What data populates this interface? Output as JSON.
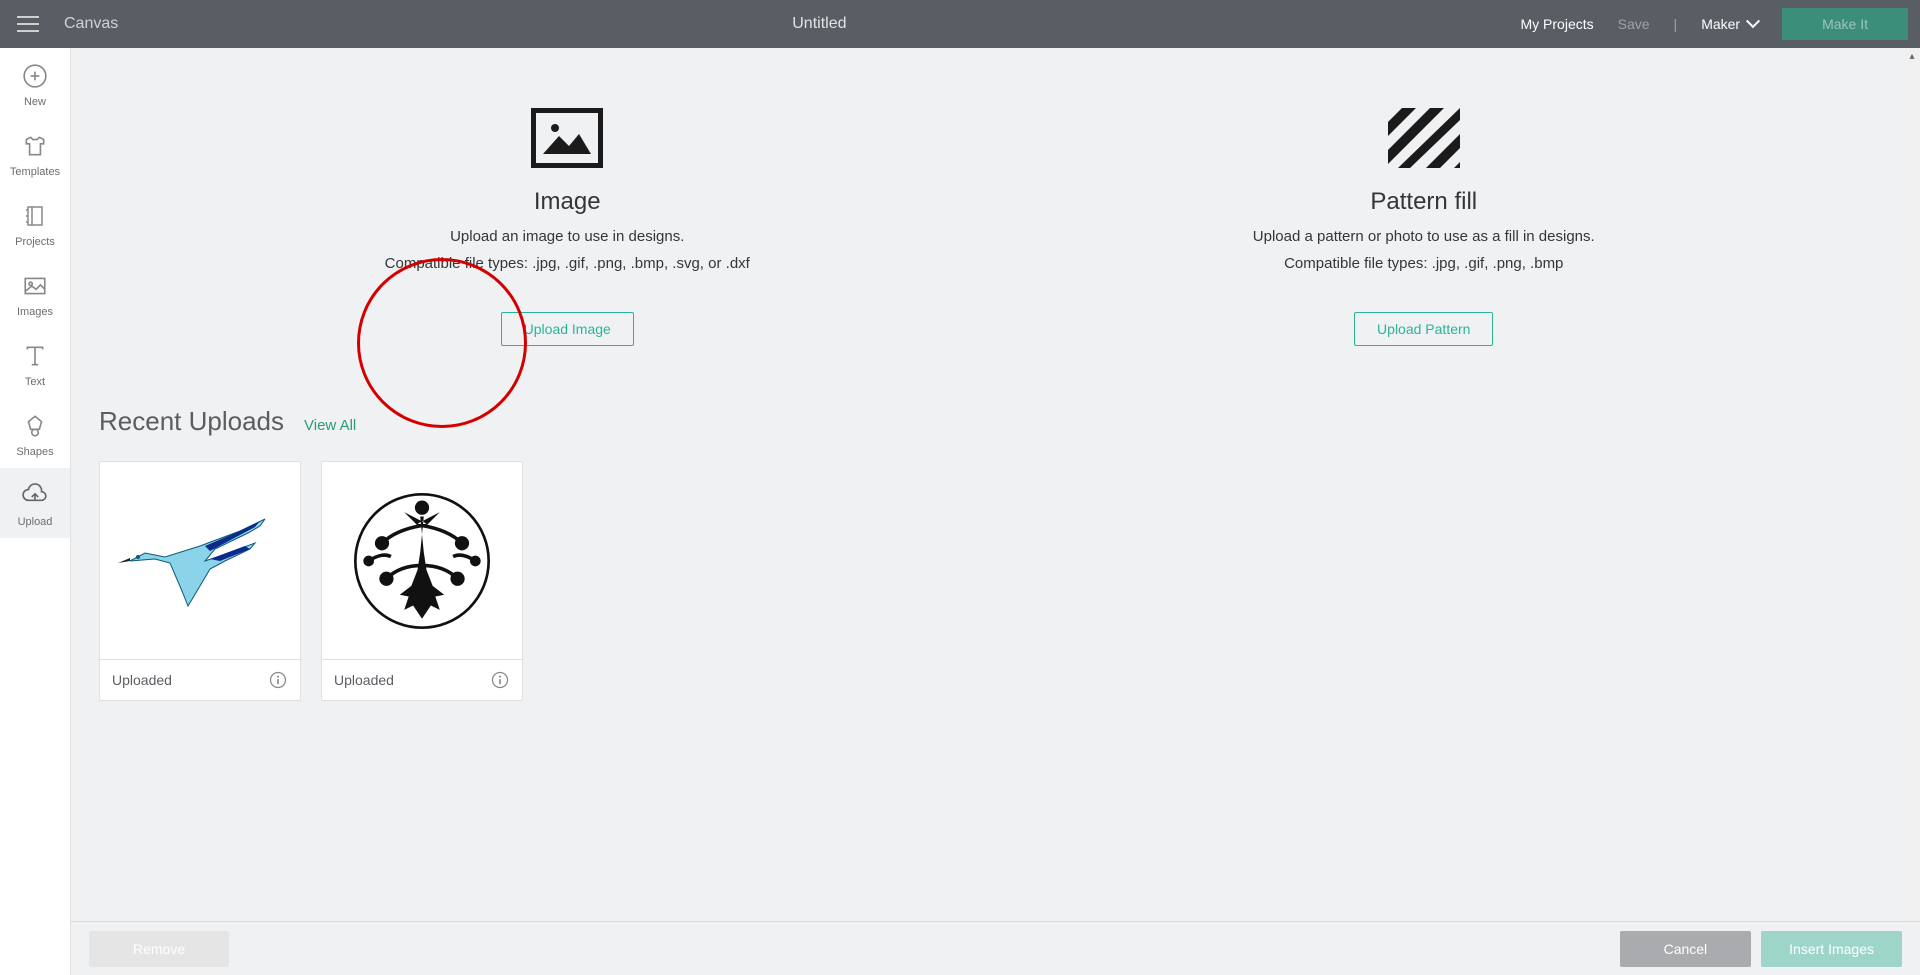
{
  "header": {
    "canvas_label": "Canvas",
    "doc_title": "Untitled",
    "my_projects": "My Projects",
    "save": "Save",
    "machine": "Maker",
    "make_it": "Make It"
  },
  "sidebar": {
    "items": [
      {
        "label": "New"
      },
      {
        "label": "Templates"
      },
      {
        "label": "Projects"
      },
      {
        "label": "Images"
      },
      {
        "label": "Text"
      },
      {
        "label": "Shapes"
      },
      {
        "label": "Upload"
      }
    ]
  },
  "upload": {
    "image": {
      "title": "Image",
      "desc": "Upload an image to use in designs.",
      "types": "Compatible file types: .jpg, .gif, .png, .bmp, .svg, or .dxf",
      "button": "Upload Image"
    },
    "pattern": {
      "title": "Pattern fill",
      "desc": "Upload a pattern or photo to use as a fill in designs.",
      "types": "Compatible file types: .jpg, .gif, .png, .bmp",
      "button": "Upload Pattern"
    }
  },
  "recent": {
    "title": "Recent Uploads",
    "view_all": "View All",
    "items": [
      {
        "label": "Uploaded"
      },
      {
        "label": "Uploaded"
      }
    ]
  },
  "footer": {
    "remove": "Remove",
    "cancel": "Cancel",
    "insert": "Insert Images"
  }
}
